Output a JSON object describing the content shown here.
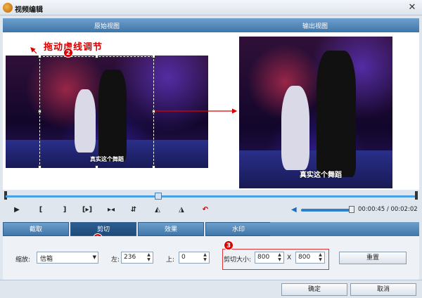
{
  "window": {
    "title": "视频编辑"
  },
  "views": {
    "original_label": "原始视图",
    "output_label": "输出视图"
  },
  "annotation": {
    "drag_text": "拖动虚线调节",
    "badge1": "1",
    "badge2": "2",
    "badge3": "3"
  },
  "video": {
    "caption": "真实这个舞蹈"
  },
  "player": {
    "current_time": "00:00:45",
    "separator": " / ",
    "total_time": "00:02:02",
    "progress": 0.37,
    "volume": 0.95
  },
  "tabs": [
    {
      "label": "截取"
    },
    {
      "label": "剪切"
    },
    {
      "label": "效果"
    },
    {
      "label": "水印"
    }
  ],
  "crop": {
    "zoom_label": "缩放:",
    "zoom_value": "信箱",
    "left_label": "左:",
    "left_value": "236",
    "top_label": "上:",
    "top_value": "0",
    "size_label": "剪切大小:",
    "width": "800",
    "x_sep": "X",
    "height": "800",
    "reset_label": "重置"
  },
  "footer": {
    "ok_label": "确定",
    "cancel_label": "取消"
  },
  "colors": {
    "accent": "#3f76a9",
    "annotation": "#dd0000"
  }
}
